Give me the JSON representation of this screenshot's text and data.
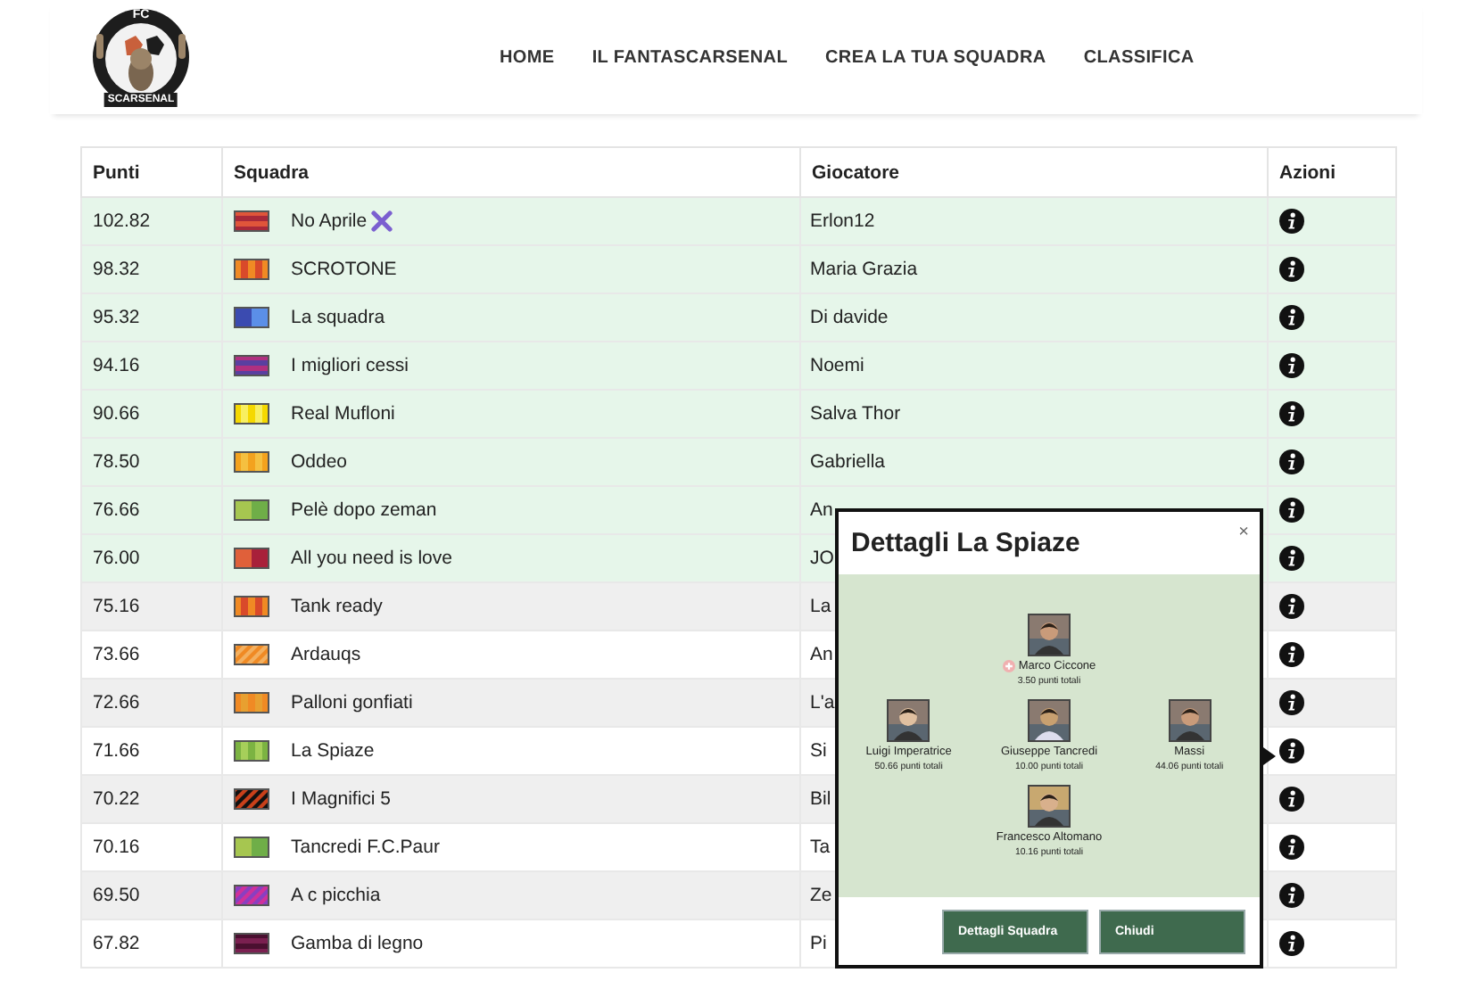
{
  "logo": {
    "top": "FC",
    "bottom": "SCARSENAL"
  },
  "nav": [
    {
      "label": "HOME"
    },
    {
      "label": "IL FANTASCARSENAL"
    },
    {
      "label": "CREA LA TUA SQUADRA"
    },
    {
      "label": "CLASSIFICA"
    }
  ],
  "table": {
    "columns": [
      "Punti",
      "Squadra",
      "Giocatore",
      "Azioni"
    ],
    "rows": [
      {
        "points": "102.82",
        "team": "No Aprile",
        "crossed": true,
        "player": "Erlon12",
        "highlighted": true,
        "kit": {
          "kind": "hstripes",
          "stripes": [
            {
              "color": "#e0553a"
            },
            {
              "color": "#a8283a"
            }
          ]
        }
      },
      {
        "points": "98.32",
        "team": "SCROTONE",
        "crossed": false,
        "player": "Maria Grazia",
        "highlighted": true,
        "kit": {
          "kind": "vstripes",
          "stripes": [
            {
              "color": "#f08a24"
            },
            {
              "color": "#d94a2a"
            }
          ]
        }
      },
      {
        "points": "95.32",
        "team": "La squadra",
        "crossed": false,
        "player": "Di davide",
        "highlighted": true,
        "kit": {
          "kind": "halves",
          "stripes": [
            {
              "color": "#3b4bb0"
            },
            {
              "color": "#5b8fe8"
            }
          ]
        }
      },
      {
        "points": "94.16",
        "team": "I migliori cessi",
        "crossed": false,
        "player": "Noemi",
        "highlighted": true,
        "kit": {
          "kind": "hstripes",
          "stripes": [
            {
              "color": "#b03080"
            },
            {
              "color": "#5a3fa0"
            }
          ]
        }
      },
      {
        "points": "90.66",
        "team": "Real Mufloni",
        "crossed": false,
        "player": "Salva Thor",
        "highlighted": true,
        "kit": {
          "kind": "vstripes",
          "stripes": [
            {
              "color": "#f5d800"
            },
            {
              "color": "#f8ef60"
            }
          ]
        }
      },
      {
        "points": "78.50",
        "team": "Oddeo",
        "crossed": false,
        "player": "Gabriella",
        "highlighted": true,
        "kit": {
          "kind": "vstripes",
          "stripes": [
            {
              "color": "#f3a21e"
            },
            {
              "color": "#f5c040"
            }
          ]
        }
      },
      {
        "points": "76.66",
        "team": "Pelè dopo zeman",
        "crossed": false,
        "player": "An",
        "highlighted": true,
        "kit": {
          "kind": "halves",
          "stripes": [
            {
              "color": "#a6c650"
            },
            {
              "color": "#6fae48"
            }
          ]
        }
      },
      {
        "points": "76.00",
        "team": "All you need is love",
        "crossed": false,
        "player": "JO",
        "highlighted": true,
        "kit": {
          "kind": "halves",
          "stripes": [
            {
              "color": "#e0603a"
            },
            {
              "color": "#a8203a"
            }
          ]
        }
      },
      {
        "points": "75.16",
        "team": "Tank ready",
        "crossed": false,
        "player": "La",
        "highlighted": false,
        "kit": {
          "kind": "vstripes",
          "stripes": [
            {
              "color": "#f08a24"
            },
            {
              "color": "#d94a2a"
            }
          ]
        }
      },
      {
        "points": "73.66",
        "team": "Ardauqs",
        "crossed": false,
        "player": "An",
        "highlighted": false,
        "kit": {
          "kind": "diagonal",
          "stripes": [
            {
              "color": "#f08a24"
            },
            {
              "color": "#f3b060"
            }
          ]
        }
      },
      {
        "points": "72.66",
        "team": "Palloni gonfiati",
        "crossed": false,
        "player": "L'a",
        "highlighted": false,
        "kit": {
          "kind": "vstripes",
          "stripes": [
            {
              "color": "#f08a24"
            },
            {
              "color": "#e8a030"
            }
          ]
        }
      },
      {
        "points": "71.66",
        "team": "La Spiaze",
        "crossed": false,
        "player": "Si",
        "highlighted": false,
        "kit": {
          "kind": "vstripes",
          "stripes": [
            {
              "color": "#7cb342"
            },
            {
              "color": "#a6cf5a"
            }
          ]
        }
      },
      {
        "points": "70.22",
        "team": "I Magnifici 5",
        "crossed": false,
        "player": "Bil",
        "highlighted": false,
        "kit": {
          "kind": "diagonal",
          "stripes": [
            {
              "color": "#111111"
            },
            {
              "color": "#c8401a"
            }
          ]
        }
      },
      {
        "points": "70.16",
        "team": "Tancredi F.C.Paur",
        "crossed": false,
        "player": "Ta",
        "highlighted": false,
        "kit": {
          "kind": "halves",
          "stripes": [
            {
              "color": "#a6c650"
            },
            {
              "color": "#6fae48"
            }
          ]
        }
      },
      {
        "points": "69.50",
        "team": "A c picchia",
        "crossed": false,
        "player": "Ze",
        "highlighted": false,
        "kit": {
          "kind": "diagonal",
          "stripes": [
            {
              "color": "#8a3fc0"
            },
            {
              "color": "#d0309a"
            }
          ]
        }
      },
      {
        "points": "67.82",
        "team": "Gamba di legno",
        "crossed": false,
        "player": "Pi",
        "highlighted": false,
        "kit": {
          "kind": "hstripes",
          "stripes": [
            {
              "color": "#4a1030"
            },
            {
              "color": "#7a2050"
            }
          ]
        }
      }
    ]
  },
  "popup": {
    "title": "Dettagli La Spiaze",
    "close": "×",
    "lines": [
      [
        {
          "name": "Marco Ciccone",
          "points": "3.50 punti totali",
          "marked": true
        }
      ],
      [
        {
          "name": "Luigi Imperatrice",
          "points": "50.66 punti totali",
          "marked": false
        },
        {
          "name": "Giuseppe Tancredi",
          "points": "10.00 punti totali",
          "marked": false
        },
        {
          "name": "Massi",
          "points": "44.06 punti totali",
          "marked": false
        }
      ],
      [
        {
          "name": "Francesco Altomano",
          "points": "10.16 punti totali",
          "marked": false
        }
      ]
    ],
    "buttons": [
      "Dettagli Squadra",
      "Chiudi"
    ]
  }
}
